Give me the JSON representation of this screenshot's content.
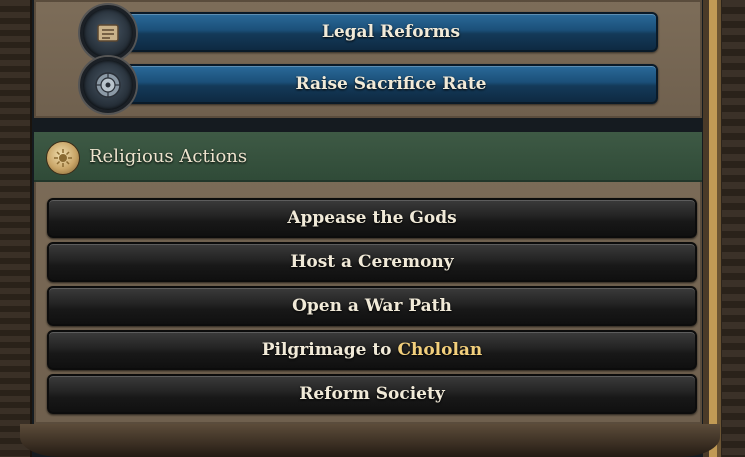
{
  "colors": {
    "accent_gold": "#f2cf7c",
    "button_blue": "#1b4f78",
    "section_green": "#2f4a37"
  },
  "top_actions": [
    {
      "label": "Legal Reforms",
      "icon": "scroll-icon"
    },
    {
      "label": "Raise Sacrifice Rate",
      "icon": "sun-stone-icon"
    }
  ],
  "religious": {
    "title": "Religious Actions",
    "icon": "sun-coin-icon",
    "actions": [
      {
        "label": "Appease the Gods"
      },
      {
        "label": "Host a Ceremony"
      },
      {
        "label": "Open a War Path"
      },
      {
        "label_prefix": "Pilgrimage to ",
        "label_highlight": "Chololan"
      },
      {
        "label": "Reform Society"
      }
    ]
  }
}
